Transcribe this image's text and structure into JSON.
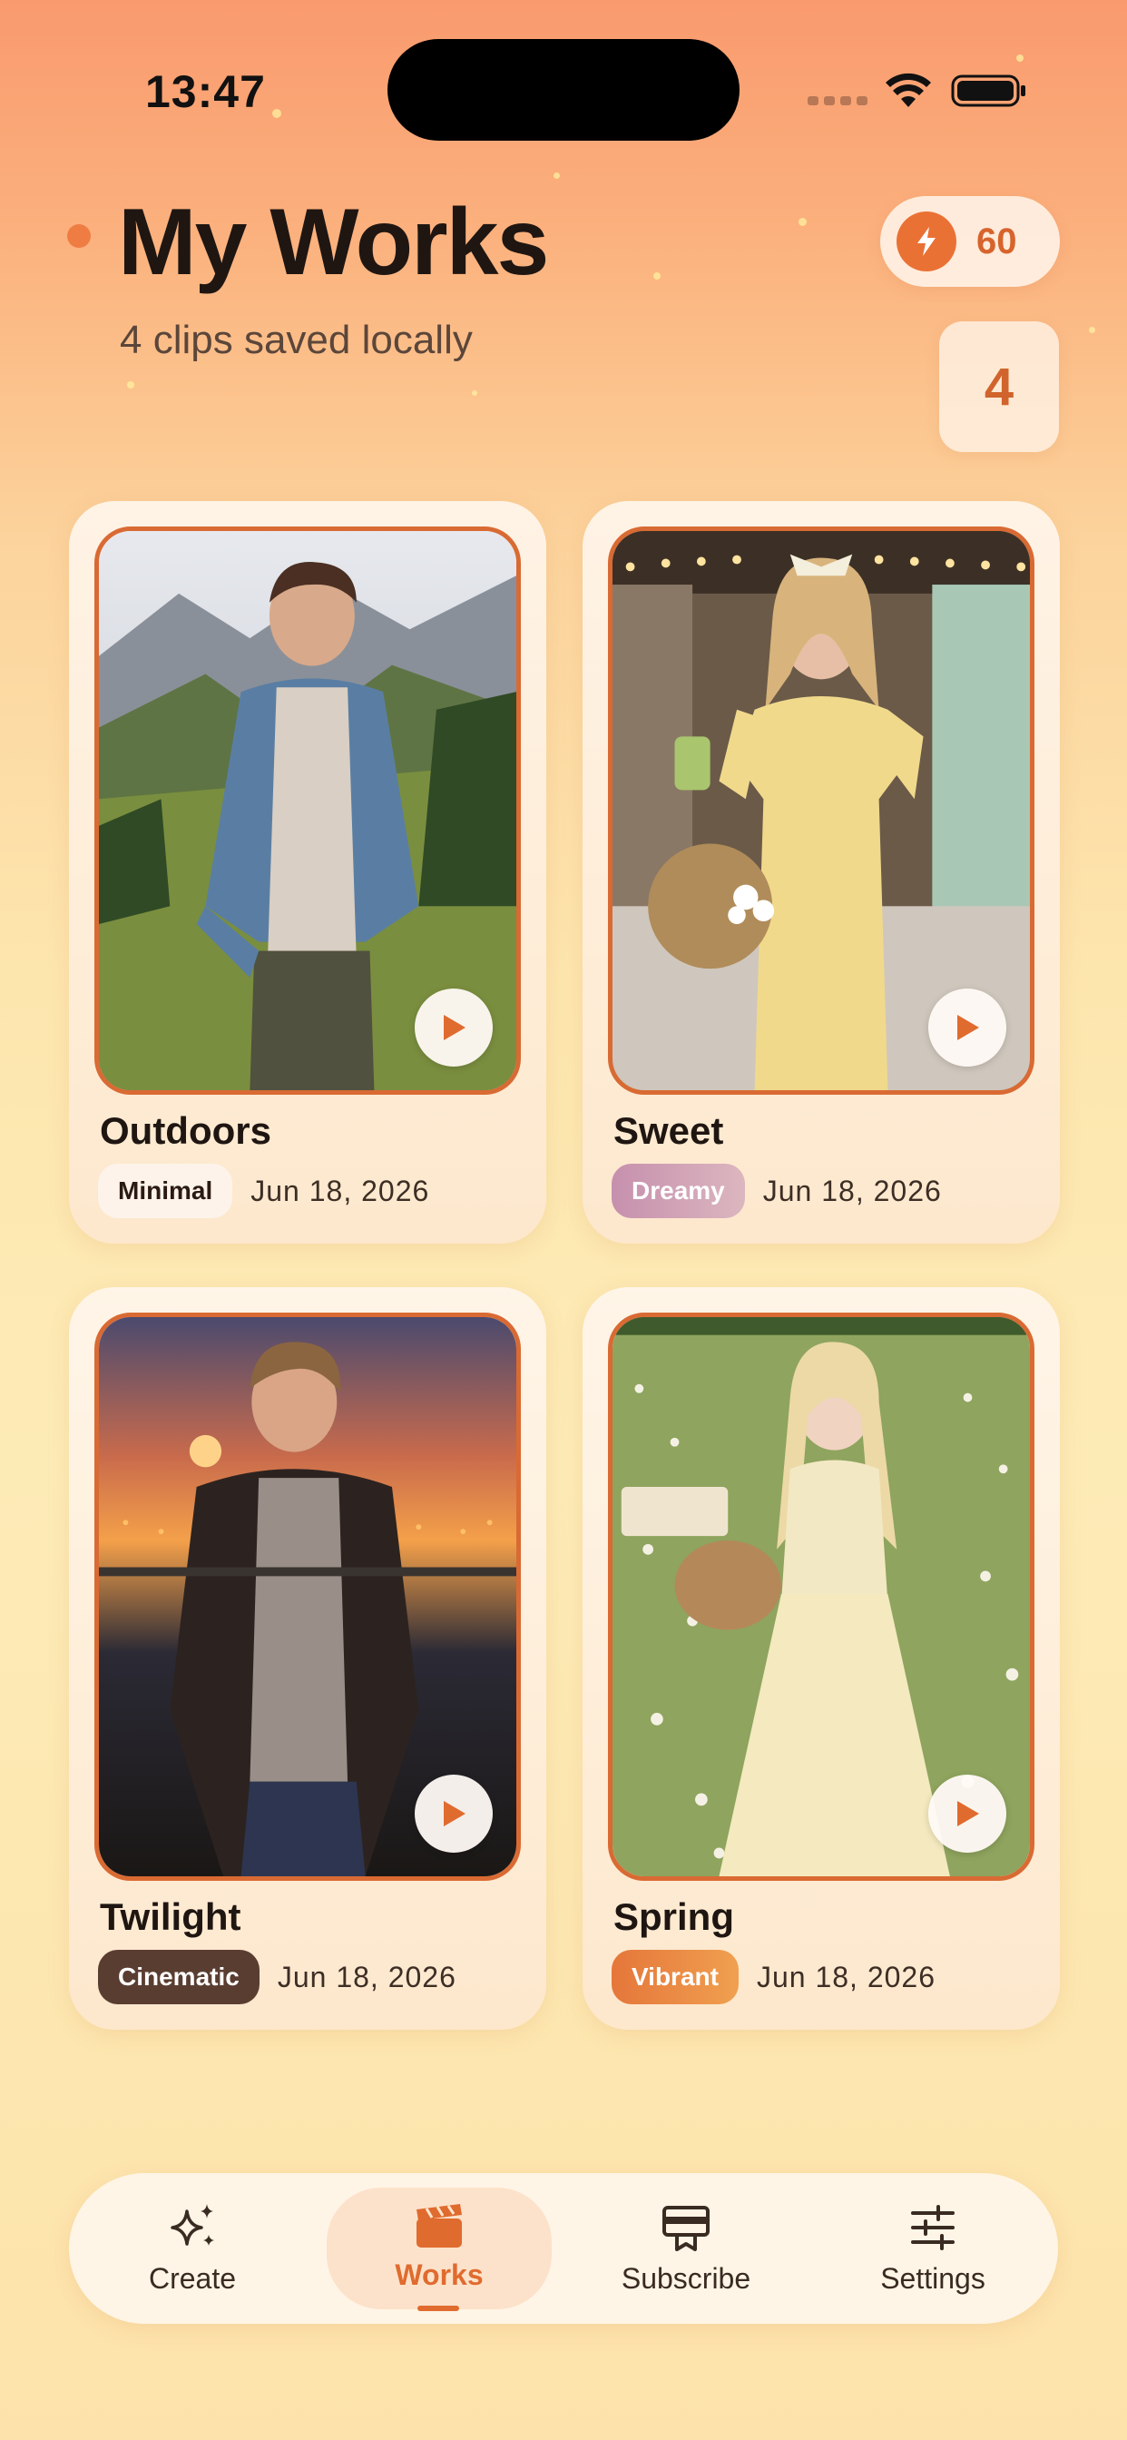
{
  "status_bar": {
    "time": "13:47"
  },
  "header": {
    "title": "My Works",
    "subtitle": "4 clips saved locally",
    "credits": "60",
    "count": "4"
  },
  "works": [
    {
      "title": "Outdoors",
      "tag": "Minimal",
      "date": "Jun 18, 2026"
    },
    {
      "title": "Sweet",
      "tag": "Dreamy",
      "date": "Jun 18, 2026"
    },
    {
      "title": "Twilight",
      "tag": "Cinematic",
      "date": "Jun 18, 2026"
    },
    {
      "title": "Spring",
      "tag": "Vibrant",
      "date": "Jun 18, 2026"
    }
  ],
  "tabs": [
    {
      "label": "Create",
      "icon": "sparkles-icon"
    },
    {
      "label": "Works",
      "icon": "clapperboard-icon",
      "active": true
    },
    {
      "label": "Subscribe",
      "icon": "subscription-icon"
    },
    {
      "label": "Settings",
      "icon": "sliders-icon"
    }
  ],
  "colors": {
    "accent": "#e06b2e",
    "tag_minimal": "#fdf3ea",
    "tag_dreamy": "#c99ab0",
    "tag_cinematic": "#5a3d31",
    "tag_vibrant": "#e8823c"
  }
}
